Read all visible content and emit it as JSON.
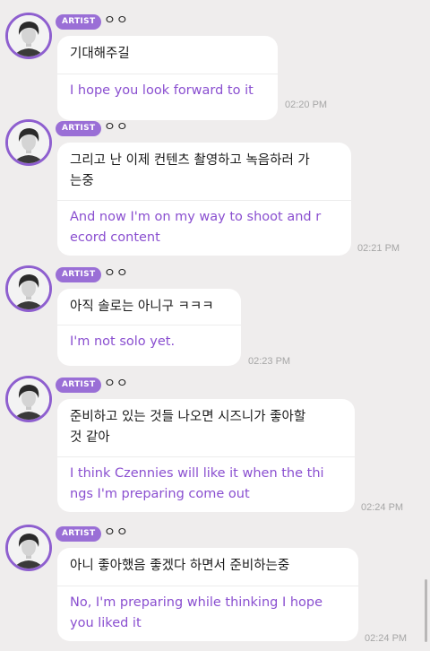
{
  "messages": [
    {
      "badge": "ARTIST",
      "name": "ㅇㅇ",
      "korean": "기대해주길",
      "english": "I hope you look forward to it",
      "time": "02:20 PM"
    },
    {
      "badge": "ARTIST",
      "name": "ㅇㅇ",
      "korean": "그리고 난 이제 컨텐츠 촬영하고 녹음하러 가\n는중",
      "english": "And now I'm on my way to shoot and r\necord content",
      "time": "02:21 PM"
    },
    {
      "badge": "ARTIST",
      "name": "ㅇㅇ",
      "korean": "아직 솔로는 아니구 ㅋㅋㅋ",
      "english": "I'm not solo yet.",
      "time": "02:23 PM"
    },
    {
      "badge": "ARTIST",
      "name": "ㅇㅇ",
      "korean": "준비하고 있는 것들 나오면 시즈니가 좋아할\n것 같아",
      "english": "I think Czennies will like it when the thi\nngs I'm preparing come out",
      "time": "02:24 PM"
    },
    {
      "badge": "ARTIST",
      "name": "ㅇㅇ",
      "korean": "아니 좋아했음 좋겠다 하면서 준비하는중",
      "english": "No, I'm preparing while thinking I hope\nyou liked it",
      "time": "02:24 PM"
    }
  ],
  "colors": {
    "background": "#efeded",
    "avatar_ring": "#8e5fcf",
    "badge": "#9a6fd6",
    "translation_text": "#8a4fd0",
    "timestamp": "#a6a6a6"
  }
}
